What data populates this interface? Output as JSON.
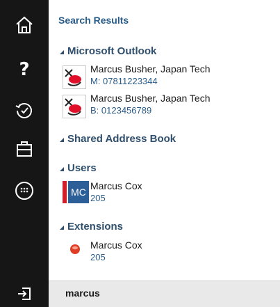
{
  "rail": {
    "icons": [
      "home-icon",
      "help-icon",
      "history-icon",
      "briefcase-icon",
      "dialpad-icon"
    ],
    "help_glyph": "?",
    "signin_icon": "sign-in-icon"
  },
  "title": "Search Results",
  "groups": {
    "outlook": {
      "label": "Microsoft Outlook",
      "items": [
        {
          "name": "Marcus Busher, Japan Tech",
          "detail": "M: 07811223344"
        },
        {
          "name": "Marcus Busher, Japan Tech",
          "detail": "B: 0123456789"
        }
      ]
    },
    "shared": {
      "label": "Shared Address Book"
    },
    "users": {
      "label": "Users",
      "items": [
        {
          "initials": "MC",
          "name": "Marcus Cox",
          "detail": "205"
        }
      ]
    },
    "extensions": {
      "label": "Extensions",
      "items": [
        {
          "name": "Marcus Cox",
          "detail": "205"
        }
      ]
    }
  },
  "search": {
    "value": "marcus"
  },
  "colors": {
    "rail": "#161616",
    "accent_blue": "#2a5c88",
    "group_header": "#2f4f6d",
    "user_badge": "#2c5f98",
    "user_flag": "#d21f2a",
    "presence_busy": "#e03b24",
    "search_bar": "#e9e9e9"
  }
}
